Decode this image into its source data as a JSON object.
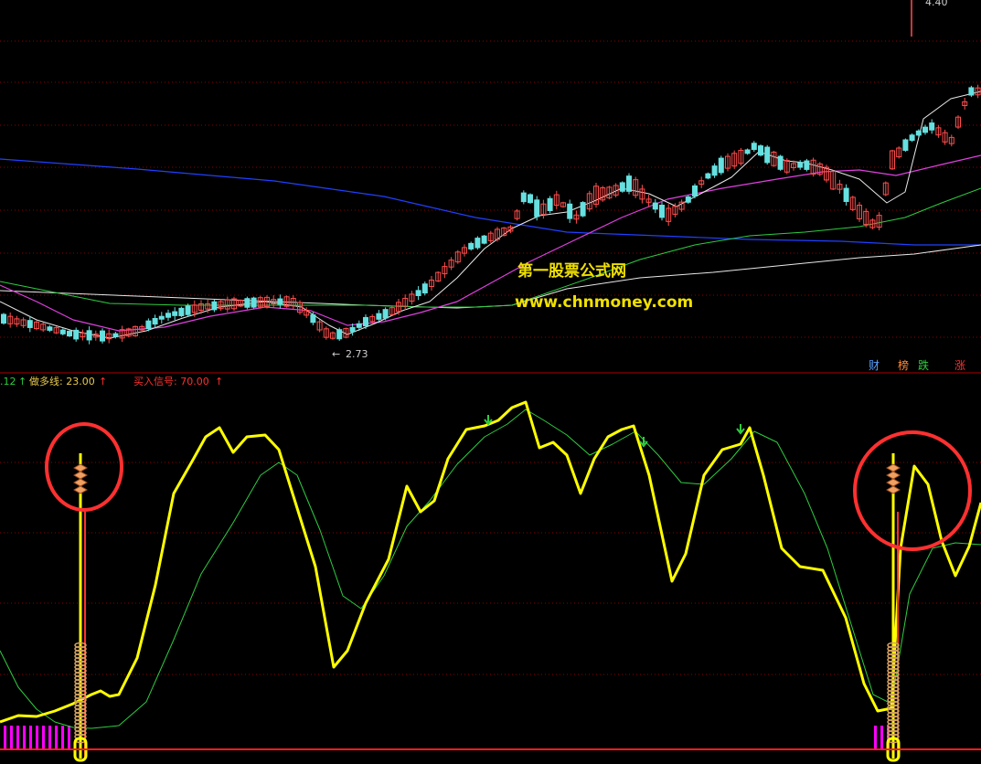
{
  "watermark": {
    "title": "第一股票公式网",
    "url": "www.chnmoney.com",
    "color": "#f0e000"
  },
  "price_panel": {
    "high_label": "4.40",
    "low_label": "2.73",
    "right_badges": [
      {
        "text": "财",
        "color": "#5aa0ff"
      },
      {
        "text": "榜",
        "color": "#ff8a3a"
      },
      {
        "text": "跌",
        "color": "#2ecc40"
      },
      {
        "text": "涨",
        "color": "#ff3030"
      }
    ]
  },
  "indicator_header": {
    "partial_value": ".12",
    "partial_value_color": "#2ecc40",
    "items": [
      {
        "label": "做多线: 23.00",
        "color": "#e8c94a"
      },
      {
        "label": "买入信号: 70.00",
        "color": "#ff3030"
      }
    ]
  },
  "colors": {
    "grid": "#8b0000",
    "separator": "#b00000",
    "ma_long": "#2040ff",
    "ma_white": "#e8e8e8",
    "ma_magenta": "#e040e0",
    "ma_green": "#2ecc40",
    "candle_up": "#ff4d4d",
    "candle_down": "#66e0e0",
    "ind_main": "#ffff00",
    "ind_signal": "#2ecc40",
    "bars": "#ff00ff",
    "circle": "#ff3030",
    "base": "#ff2020"
  }
}
